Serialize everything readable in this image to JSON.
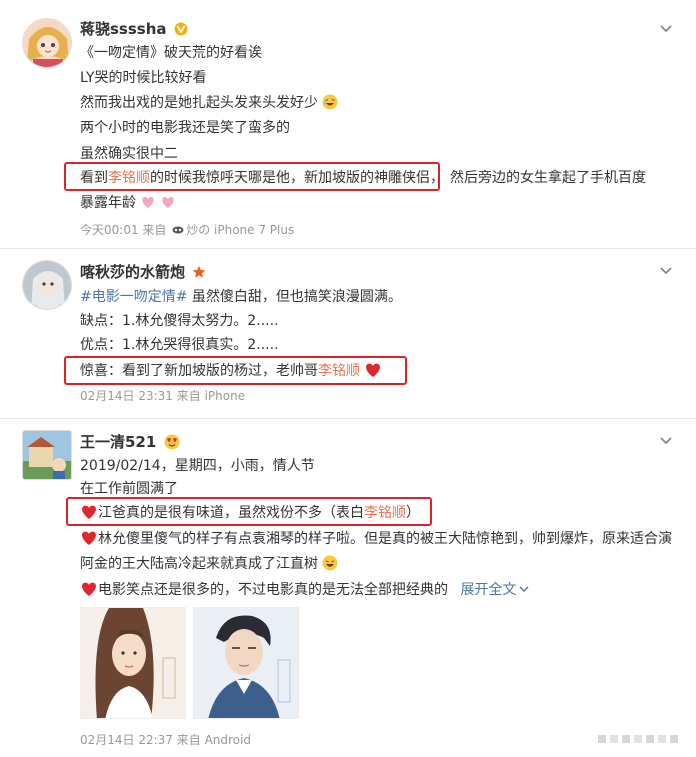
{
  "posts": [
    {
      "username": "蒋骁ssssha",
      "lines": [
        "《一吻定情》破天荒的好看诶",
        "LY哭的时候比较好看",
        "然而我出戏的是她扎起头发来头发好少",
        "两个小时的电影我还是笑了蛮多的",
        "虽然确实很中二"
      ],
      "highlight_pre": "看到",
      "highlight_name": "李铭顺",
      "highlight_post": "的时候我惊呼天哪是他，新加坡版的神雕侠侣，",
      "highlight_tail": "然后旁边的女生拿起了手机百度",
      "last_line": "暴露年龄",
      "meta": "今天00:01 来自 ",
      "device": "炒の iPhone 7 Plus"
    },
    {
      "username": "喀秋莎的水箭炮",
      "topic": "#电影一吻定情#",
      "topic_rest": " 虽然傻白甜，但也搞笑浪漫圆满。",
      "lines": [
        "缺点：1.林允傻得太努力。2.....",
        "优点：1.林允哭得很真实。2....."
      ],
      "highlight_pre": "惊喜：看到了新加坡版的杨过，老帅哥",
      "highlight_name": "李铭顺",
      "meta": "02月14日 23:31 来自 iPhone"
    },
    {
      "username": "王一清521",
      "lines": [
        "2019/02/14，星期四，小雨，情人节",
        "在工作前圆满了"
      ],
      "highlight_pre": "江爸真的是很有味道，虽然戏份不多（表白",
      "highlight_name": "李铭顺",
      "highlight_post": "）",
      "line_a": "林允傻里傻气的样子有点袁湘琴的样子啦。但是真的被王大陆惊艳到，帅到爆炸，原来适合演",
      "line_b": "阿金的王大陆高冷起来就真成了江直树",
      "line_c": "电影笑点还是很多的，不过电影真的是无法全部把经典的",
      "expand": "展开全文",
      "meta": "02月14日 22:37 来自 Android"
    }
  ],
  "watermark": "·"
}
